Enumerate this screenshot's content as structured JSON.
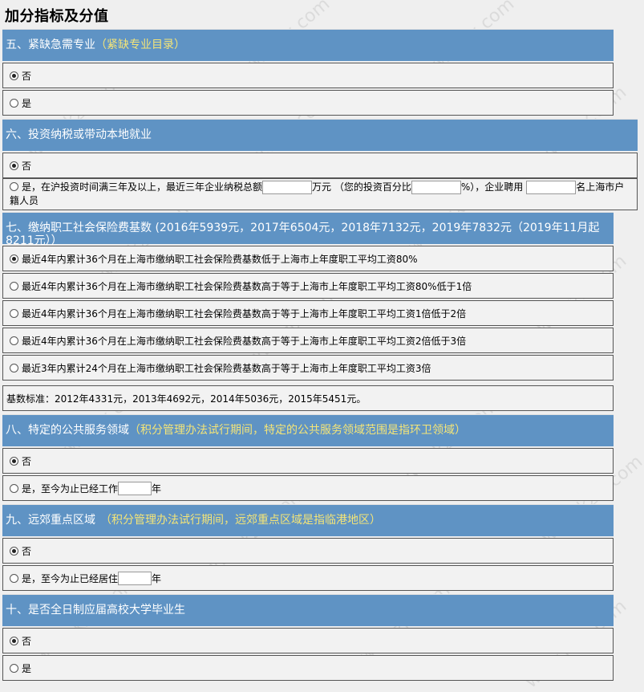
{
  "page_title": "加分指标及分值",
  "watermark": "www.kzix.com",
  "sections": {
    "s5": {
      "title": "五、紧缺急需专业",
      "hint": "（紧缺专业目录）",
      "opt_no": "否",
      "opt_yes": "是"
    },
    "s6": {
      "title": "六、投资纳税或带动本地就业",
      "opt_no": "否",
      "opt_yes_a": "是，在沪投资时间满三年及以上，最近三年企业纳税总额",
      "opt_yes_b": "万元 （您的投资百分比",
      "opt_yes_c": "%），企业聘用",
      "opt_yes_d": "名上海市户",
      "opt_yes_e": "籍人员"
    },
    "s7": {
      "title": "七、缴纳职工社会保险费基数 (2016年5939元，2017年6504元，2018年7132元，2019年7832元（2019年11月起8211元））",
      "opts": [
        "最近4年内累计36个月在上海市缴纳职工社会保险费基数低于上海市上年度职工平均工资80%",
        "最近4年内累计36个月在上海市缴纳职工社会保险费基数高于等于上海市上年度职工平均工资80%低于1倍",
        "最近4年内累计36个月在上海市缴纳职工社会保险费基数高于等于上海市上年度职工平均工资1倍低于2倍",
        "最近4年内累计36个月在上海市缴纳职工社会保险费基数高于等于上海市上年度职工平均工资2倍低于3倍",
        "最近3年内累计24个月在上海市缴纳职工社会保险费基数高于等于上海市上年度职工平均工资3倍"
      ],
      "note": "基数标准：2012年4331元，2013年4692元，2014年5036元，2015年5451元。"
    },
    "s8": {
      "title": "八、特定的公共服务领域",
      "hint": "（积分管理办法试行期间，特定的公共服务领域范围是指环卫领域）",
      "opt_no": "否",
      "opt_yes_a": "是，至今为止已经工作",
      "opt_yes_b": "年"
    },
    "s9": {
      "title": "九、远郊重点区域",
      "hint": "（积分管理办法试行期间，远郊重点区域是指临港地区）",
      "opt_no": "否",
      "opt_yes_a": "是，至今为止已经居住",
      "opt_yes_b": "年"
    },
    "s10": {
      "title": "十、是否全日制应届高校大学毕业生",
      "opt_no": "否",
      "opt_yes": "是"
    }
  }
}
